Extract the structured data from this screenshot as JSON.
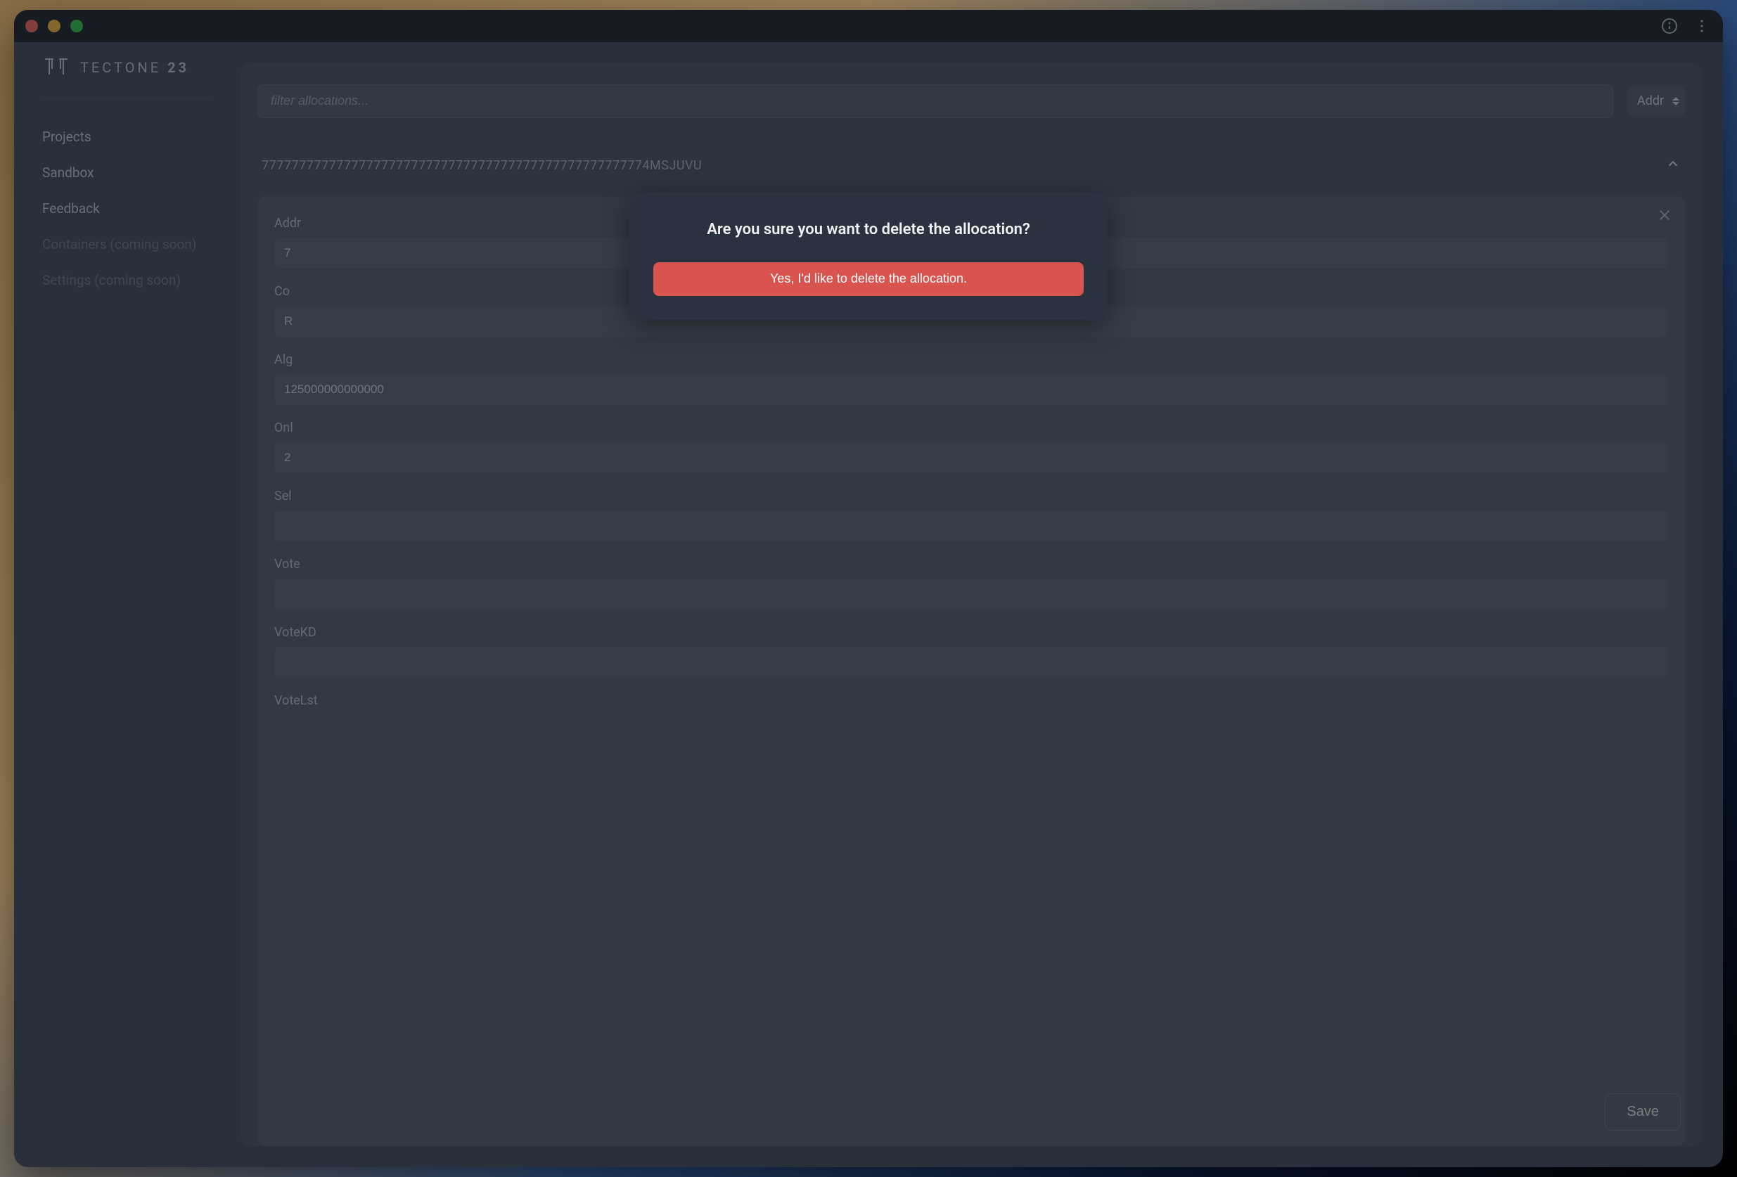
{
  "logo": {
    "name": "TECTONE",
    "num": "23"
  },
  "sidebar": {
    "items": [
      {
        "label": "Projects",
        "enabled": true
      },
      {
        "label": "Sandbox",
        "enabled": true
      },
      {
        "label": "Feedback",
        "enabled": true
      },
      {
        "label": "Containers (coming soon)",
        "enabled": false
      },
      {
        "label": "Settings (coming soon)",
        "enabled": false
      }
    ]
  },
  "filter": {
    "placeholder": "filter allocations..."
  },
  "filter_select": {
    "value": "Addr"
  },
  "allocation": {
    "title": "7777777777777777777777777777777777777777777777777774MSJUVU",
    "fields": [
      {
        "label": "Addr",
        "value": "7"
      },
      {
        "label": "Co",
        "value": "R"
      },
      {
        "label": "Alg",
        "value": "125000000000000"
      },
      {
        "label": "Onl",
        "value": "2"
      },
      {
        "label": "Sel",
        "value": ""
      },
      {
        "label": "Vote",
        "value": ""
      },
      {
        "label": "VoteKD",
        "value": ""
      },
      {
        "label": "VoteLst",
        "value": ""
      }
    ]
  },
  "save_label": "Save",
  "modal": {
    "title": "Are you sure you want to delete the allocation?",
    "confirm": "Yes, I'd like to delete the allocation."
  },
  "colors": {
    "danger": "#d9534f",
    "panel": "#424a58",
    "panel_inner": "#4b5463",
    "bg": "#3a4250"
  }
}
